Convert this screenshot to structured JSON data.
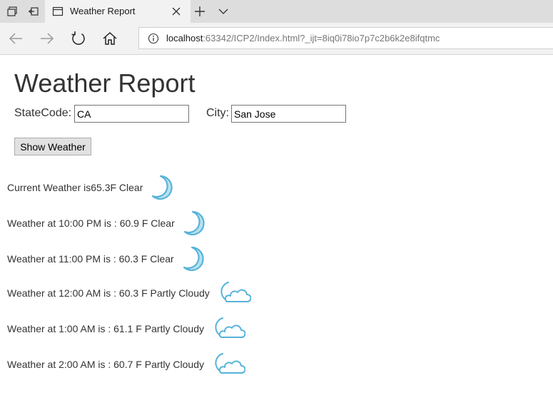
{
  "browser": {
    "tab_title": "Weather Report",
    "url_host": "localhost",
    "url_rest": ":63342/ICP2/Index.html?_ijt=8iq0i78io7p7c2b6k2e8ifqtmc"
  },
  "page": {
    "title": "Weather Report",
    "state_label": "StateCode:",
    "state_value": "CA",
    "city_label": "City:",
    "city_value": "San Jose",
    "button_label": "Show Weather"
  },
  "weather": [
    {
      "text": "Current Weather is65.3F Clear",
      "icon": "moon-icon"
    },
    {
      "text": "Weather at 10:00 PM is : 60.9 F Clear",
      "icon": "moon-icon"
    },
    {
      "text": "Weather at 11:00 PM is : 60.3 F Clear",
      "icon": "moon-icon"
    },
    {
      "text": "Weather at 12:00 AM is : 60.3 F Partly Cloudy",
      "icon": "moon-cloud-icon"
    },
    {
      "text": "Weather at 1:00 AM is : 61.1 F Partly Cloudy",
      "icon": "moon-cloud-icon"
    },
    {
      "text": "Weather at 2:00 AM is : 60.7 F Partly Cloudy",
      "icon": "moon-cloud-icon"
    }
  ],
  "colors": {
    "icon_fill": "#b9e1ee",
    "icon_stroke": "#56b3da"
  }
}
